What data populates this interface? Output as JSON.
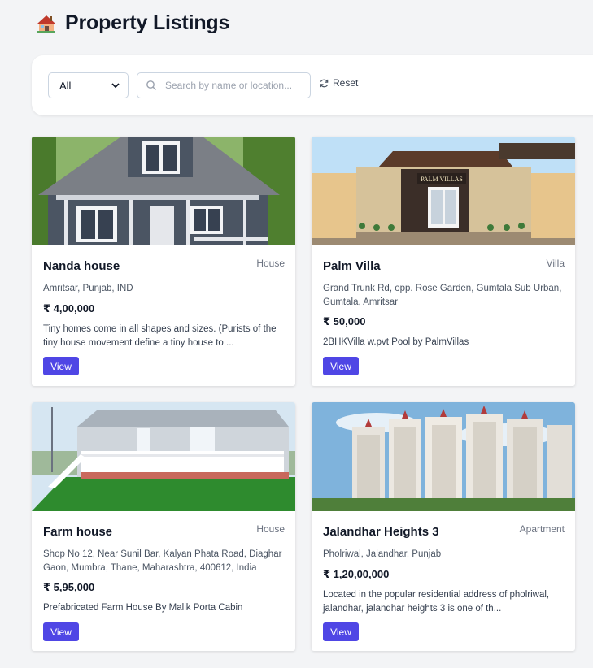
{
  "page": {
    "title": "Property Listings",
    "icon": "house-icon"
  },
  "filters": {
    "type_select": {
      "selected": "All"
    },
    "search": {
      "placeholder": "Search by name or location...",
      "value": ""
    },
    "reset_label": "Reset"
  },
  "listings": [
    {
      "name": "Nanda house",
      "type": "House",
      "address": "Amritsar, Punjab, IND",
      "price": "₹ 4,00,000",
      "description": "Tiny homes come in all shapes and sizes. (Purists of the tiny house movement define a tiny house to ...",
      "button": "View"
    },
    {
      "name": "Palm Villa",
      "type": "Villa",
      "address": "Grand Trunk Rd, opp. Rose Garden, Gumtala Sub Urban, Gumtala, Amritsar",
      "price": "₹ 50,000",
      "description": "2BHKVilla w.pvt Pool by PalmVillas",
      "button": "View",
      "image_sign": "PALM VILLAS"
    },
    {
      "name": "Farm house",
      "type": "House",
      "address": "Shop No 12, Near Sunil Bar, Kalyan Phata Road, Diaghar Gaon, Mumbra, Thane, Maharashtra, 400612, India",
      "price": "₹ 5,95,000",
      "description": "Prefabricated Farm House By Malik Porta Cabin",
      "button": "View"
    },
    {
      "name": "Jalandhar Heights 3",
      "type": "Apartment",
      "address": "Pholriwal, Jalandhar, Punjab",
      "price": "₹ 1,20,00,000",
      "description": "Located in the popular residential address of pholriwal, jalandhar, jalandhar heights 3 is one of th...",
      "button": "View"
    }
  ],
  "colors": {
    "accent": "#4f46e5",
    "background": "#f3f4f6",
    "card": "#ffffff"
  }
}
